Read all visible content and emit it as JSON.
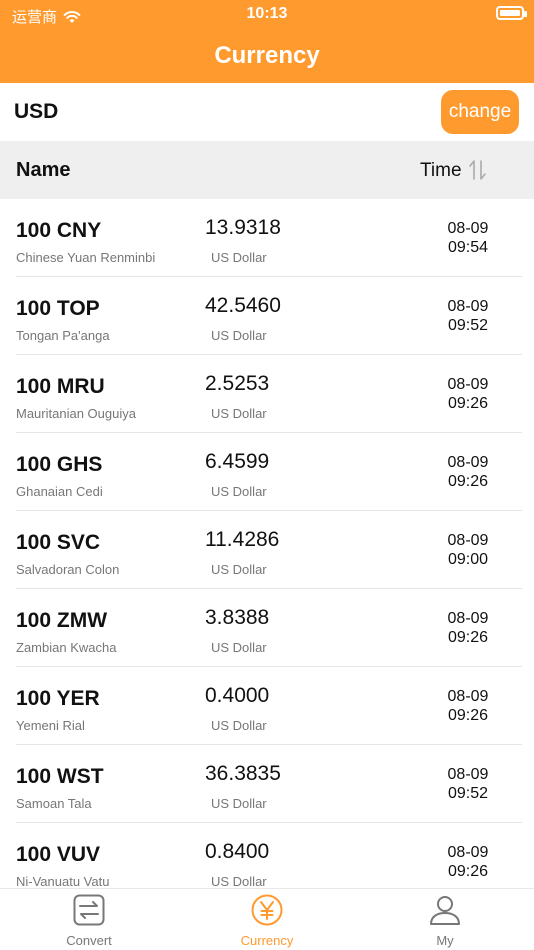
{
  "status_bar": {
    "carrier": "运营商",
    "time": "10:13"
  },
  "header": {
    "title": "Currency"
  },
  "base": {
    "code": "USD",
    "change_label": "change"
  },
  "columns": {
    "name": "Name",
    "time": "Time"
  },
  "rates": [
    {
      "code": "100 CNY",
      "name": "Chinese Yuan Renminbi",
      "value": "13.9318",
      "unit": "US Dollar",
      "date": "08-09",
      "time": "09:54"
    },
    {
      "code": "100 TOP",
      "name": "Tongan Pa'anga",
      "value": "42.5460",
      "unit": "US Dollar",
      "date": "08-09",
      "time": "09:52"
    },
    {
      "code": "100 MRU",
      "name": "Mauritanian Ouguiya",
      "value": "2.5253",
      "unit": "US Dollar",
      "date": "08-09",
      "time": "09:26"
    },
    {
      "code": "100 GHS",
      "name": "Ghanaian Cedi",
      "value": "6.4599",
      "unit": "US Dollar",
      "date": "08-09",
      "time": "09:26"
    },
    {
      "code": "100 SVC",
      "name": "Salvadoran Colon",
      "value": "11.4286",
      "unit": "US Dollar",
      "date": "08-09",
      "time": "09:00"
    },
    {
      "code": "100 ZMW",
      "name": "Zambian Kwacha",
      "value": "3.8388",
      "unit": "US Dollar",
      "date": "08-09",
      "time": "09:26"
    },
    {
      "code": "100 YER",
      "name": "Yemeni Rial",
      "value": "0.4000",
      "unit": "US Dollar",
      "date": "08-09",
      "time": "09:26"
    },
    {
      "code": "100 WST",
      "name": "Samoan Tala",
      "value": "36.3835",
      "unit": "US Dollar",
      "date": "08-09",
      "time": "09:52"
    },
    {
      "code": "100 VUV",
      "name": "Ni-Vanuatu Vatu",
      "value": "0.8400",
      "unit": "US Dollar",
      "date": "08-09",
      "time": "09:26"
    }
  ],
  "tabs": [
    {
      "label": "Convert",
      "icon": "convert-icon",
      "active": false
    },
    {
      "label": "Currency",
      "icon": "yen-coin-icon",
      "active": true
    },
    {
      "label": "My",
      "icon": "person-icon",
      "active": false
    }
  ],
  "colors": {
    "accent": "#ff9a2e",
    "header_bg": "#efefef",
    "muted_text": "#777777"
  }
}
